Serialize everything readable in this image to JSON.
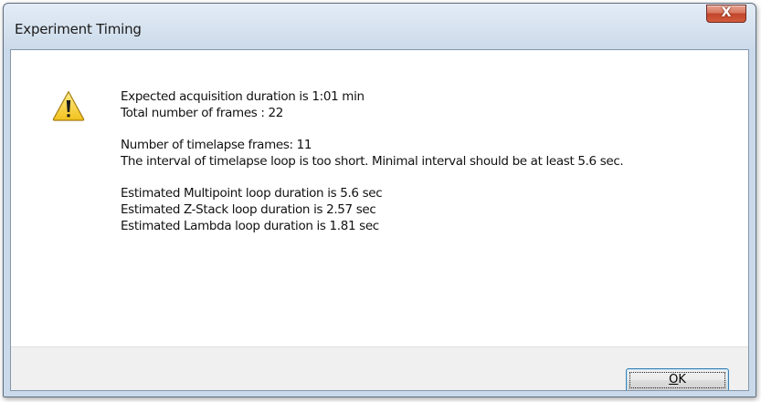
{
  "window": {
    "title": "Experiment Timing",
    "close_glyph": "X"
  },
  "icon": {
    "name": "warning-icon"
  },
  "messages": {
    "duration": "Expected acquisition duration is 1:01 min",
    "total_frames": "Total number of frames :  22",
    "timelapse_frames": "Number of timelapse frames:  11",
    "interval_warning": "The interval of timelapse loop is too short. Minimal interval should be at least 5.6 sec.",
    "multipoint": "Estimated Multipoint loop duration is 5.6 sec",
    "zstack": "Estimated Z-Stack loop duration is 2.57 sec",
    "lambda": "Estimated Lambda loop duration is 1.81 sec"
  },
  "buttons": {
    "ok_mnemonic": "O",
    "ok_rest": "K"
  },
  "colors": {
    "warning_yellow": "#f7d23b",
    "close_red": "#c2452c",
    "footer_gray": "#f0f0f0"
  }
}
